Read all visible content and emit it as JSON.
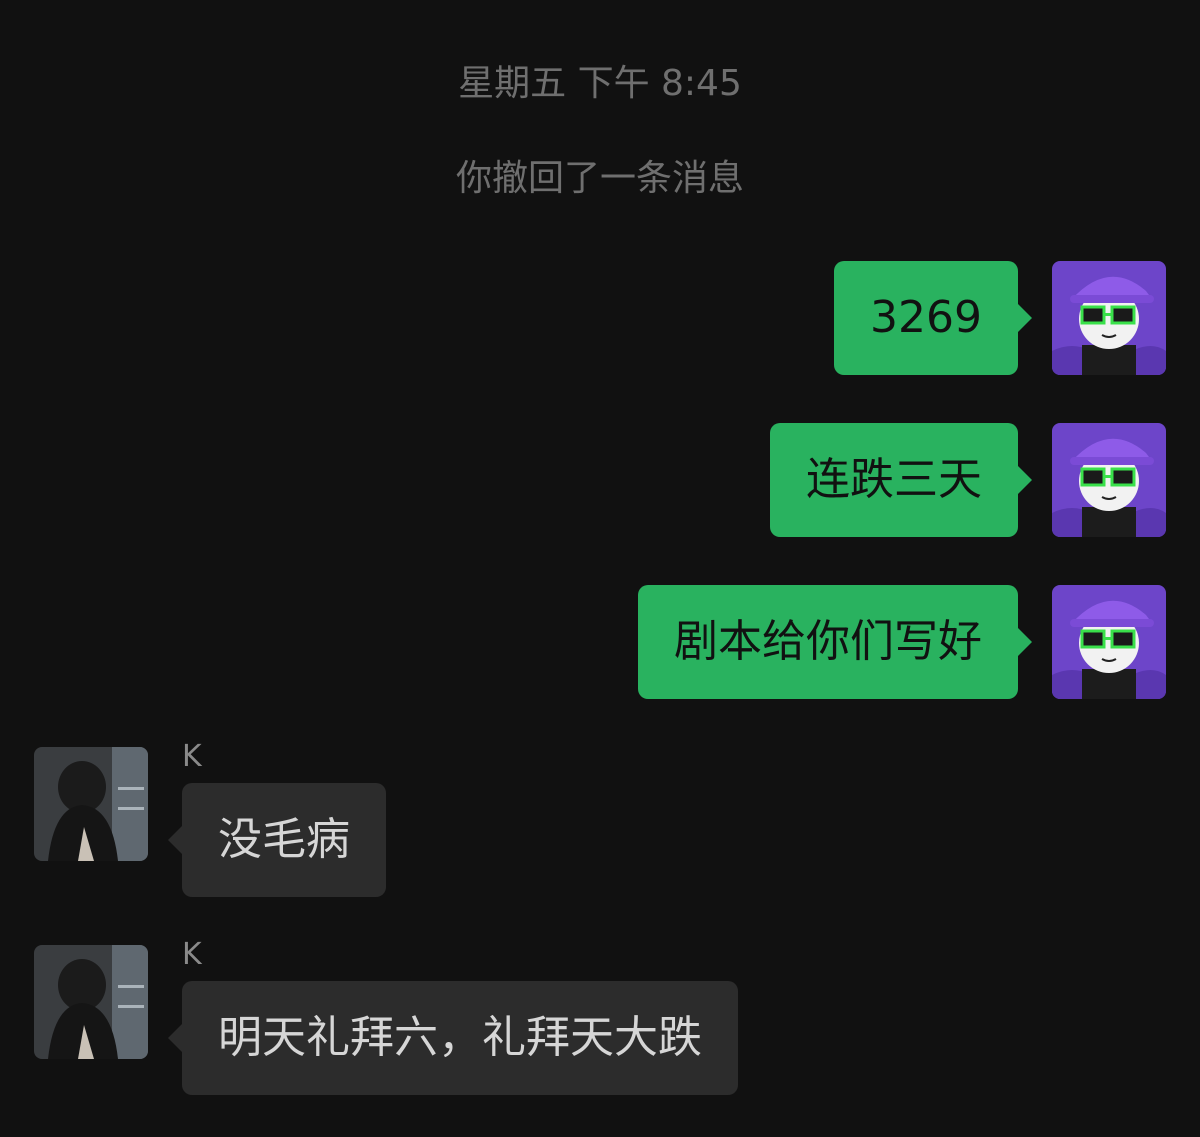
{
  "colors": {
    "background": "#111111",
    "outgoing_bubble": "#29b25f",
    "incoming_bubble": "#2c2c2c",
    "system_text": "#6f6f6f"
  },
  "chat": {
    "timestamp": "星期五 下午 8:45",
    "recall_notice": "你撤回了一条消息",
    "messages": [
      {
        "direction": "outgoing",
        "text": "3269",
        "avatar": "purple-cap-avatar-icon"
      },
      {
        "direction": "outgoing",
        "text": "连跌三天",
        "avatar": "purple-cap-avatar-icon"
      },
      {
        "direction": "outgoing",
        "text": "剧本给你们写好",
        "avatar": "purple-cap-avatar-icon"
      },
      {
        "direction": "incoming",
        "sender": "K",
        "text": "没毛病",
        "avatar": "hooded-figure-avatar-icon"
      },
      {
        "direction": "incoming",
        "sender": "K",
        "text": "明天礼拜六，礼拜天大跌",
        "avatar": "hooded-figure-avatar-icon"
      }
    ]
  }
}
